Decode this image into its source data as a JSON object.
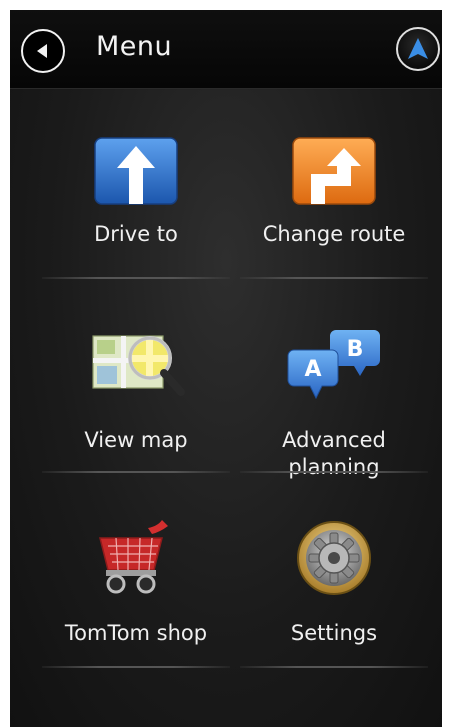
{
  "header": {
    "title": "Menu",
    "back_icon": "back-arrow-icon",
    "nav_icon": "navigation-arrow-icon",
    "accent_color": "#3a8ee6"
  },
  "menu": {
    "items": [
      {
        "label": "Drive to",
        "icon": "straight-arrow-icon",
        "color": "#2f6fc4"
      },
      {
        "label": "Change route",
        "icon": "detour-arrow-icon",
        "color": "#e87a1f"
      },
      {
        "label": "View map",
        "icon": "map-magnifier-icon",
        "color": "#e8e25a"
      },
      {
        "label": "Advanced planning",
        "label_line1": "Advanced",
        "label_line2": "planning",
        "icon": "ab-markers-icon",
        "color": "#3a7ad6"
      },
      {
        "label": "TomTom shop",
        "icon": "shopping-cart-icon",
        "color": "#c62828"
      },
      {
        "label": "Settings",
        "icon": "gear-icon",
        "color": "#c9a24a"
      }
    ]
  }
}
